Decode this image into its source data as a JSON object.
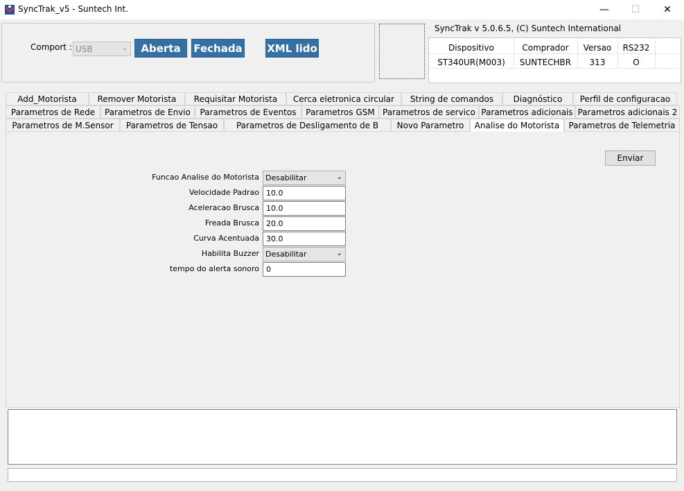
{
  "window": {
    "title": "SyncTrak_v5 - Suntech Int.",
    "min_glyph": "—",
    "max_glyph": "☐",
    "close_glyph": "✕",
    "app_icon": "synctrak-logo-icon"
  },
  "top": {
    "comport_label": "Comport :",
    "comport_value": "USB",
    "aberta_label": "Aberta",
    "fechada_label": "Fechada",
    "xml_label": "XML lido",
    "version_text": "SyncTrak v 5.0.6.5, (C) Suntech International"
  },
  "device_table": {
    "headers": [
      "Dispositivo",
      "Comprador",
      "Versao",
      "RS232"
    ],
    "row": [
      "ST340UR(M003)",
      "SUNTECHBR",
      "313",
      "O"
    ]
  },
  "tabs": {
    "row1": [
      "Add_Motorista",
      "Remover Motorista",
      "Requisitar Motorista",
      "Cerca eletronica circular",
      "String de comandos",
      "Diagnóstico",
      "Perfil de configuracao"
    ],
    "row2": [
      "Parametros de Rede",
      "Parametros de Envio",
      "Parametros de Eventos",
      "Parametros GSM",
      "Parametros de servico",
      "Parametros adicionais",
      "Parametros adicionais 2"
    ],
    "row3": [
      "Parametros  de M.Sensor",
      "Parametros de Tensao",
      "Parametros de Desligamento de B",
      "Novo Parametro",
      "Analise do Motorista",
      "Parametros de Telemetria"
    ],
    "active": "Analise do Motorista"
  },
  "form": {
    "enviar_label": "Enviar",
    "funcao_label": "Funcao Analise do Motorista",
    "funcao_value": "Desabilitar",
    "velocidade_label": "Velocidade Padrao",
    "velocidade_value": "10.0",
    "aceleracao_label": "Aceleracao Brusca",
    "aceleracao_value": "10.0",
    "freada_label": "Freada Brusca",
    "freada_value": "20.0",
    "curva_label": "Curva Acentuada",
    "curva_value": "30.0",
    "buzzer_label": "Habilita Buzzer",
    "buzzer_value": "Desabilitar",
    "tempo_label": "tempo do alerta sonoro",
    "tempo_value": "0"
  },
  "log": {
    "text": ""
  },
  "status": {
    "text": ""
  }
}
